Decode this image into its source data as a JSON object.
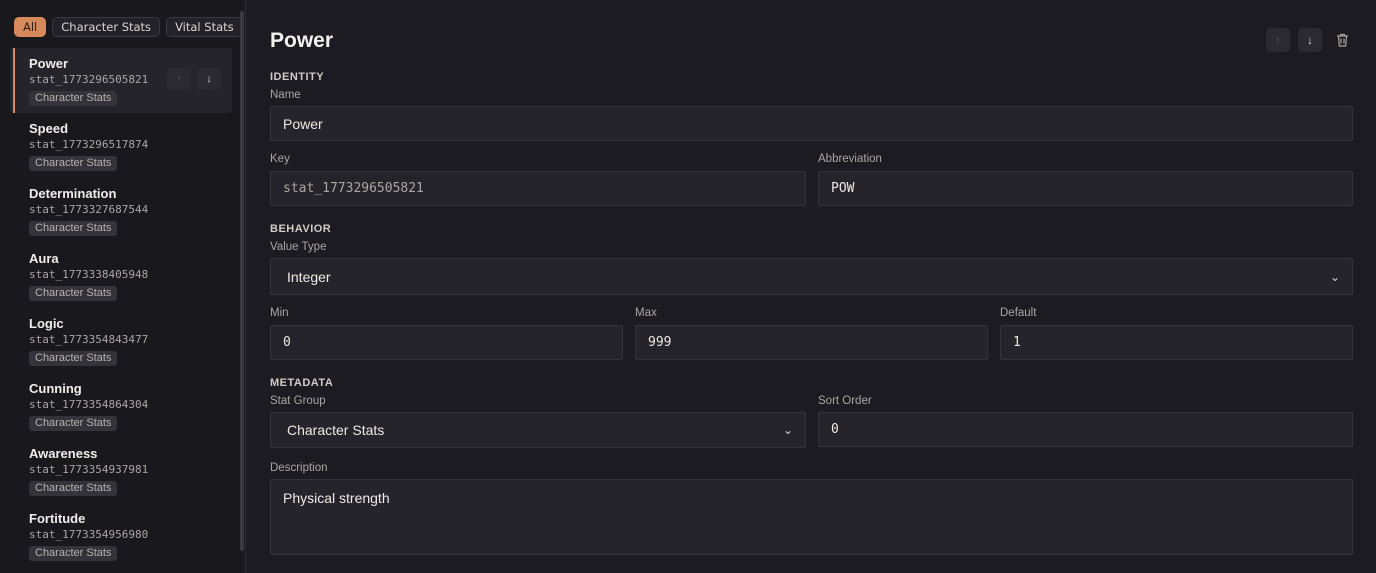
{
  "filters": [
    "All",
    "Character Stats",
    "Vital Stats"
  ],
  "stats": [
    {
      "name": "Power",
      "key": "stat_1773296505821",
      "group": "Character Stats"
    },
    {
      "name": "Speed",
      "key": "stat_1773296517874",
      "group": "Character Stats"
    },
    {
      "name": "Determination",
      "key": "stat_1773327687544",
      "group": "Character Stats"
    },
    {
      "name": "Aura",
      "key": "stat_1773338405948",
      "group": "Character Stats"
    },
    {
      "name": "Logic",
      "key": "stat_1773354843477",
      "group": "Character Stats"
    },
    {
      "name": "Cunning",
      "key": "stat_1773354864304",
      "group": "Character Stats"
    },
    {
      "name": "Awareness",
      "key": "stat_1773354937981",
      "group": "Character Stats"
    },
    {
      "name": "Fortitude",
      "key": "stat_1773354956980",
      "group": "Character Stats"
    }
  ],
  "detail": {
    "title": "Power",
    "sections": {
      "identity": "IDENTITY",
      "behavior": "BEHAVIOR",
      "metadata": "METADATA"
    },
    "labels": {
      "name": "Name",
      "key": "Key",
      "abbreviation": "Abbreviation",
      "value_type": "Value Type",
      "min": "Min",
      "max": "Max",
      "default": "Default",
      "stat_group": "Stat Group",
      "sort_order": "Sort Order",
      "description": "Description"
    },
    "values": {
      "name": "Power",
      "key": "stat_1773296505821",
      "abbreviation": "POW",
      "value_type": "Integer",
      "min": "0",
      "max": "999",
      "default": "1",
      "stat_group": "Character Stats",
      "sort_order": "0",
      "description": "Physical strength"
    }
  },
  "icons": {
    "up": "arrow-up-icon",
    "down": "arrow-down-icon",
    "delete": "trash-icon",
    "chevron": "chevron-down-icon"
  },
  "colors": {
    "accent": "#d68a5c",
    "background": "#1c1b21"
  }
}
